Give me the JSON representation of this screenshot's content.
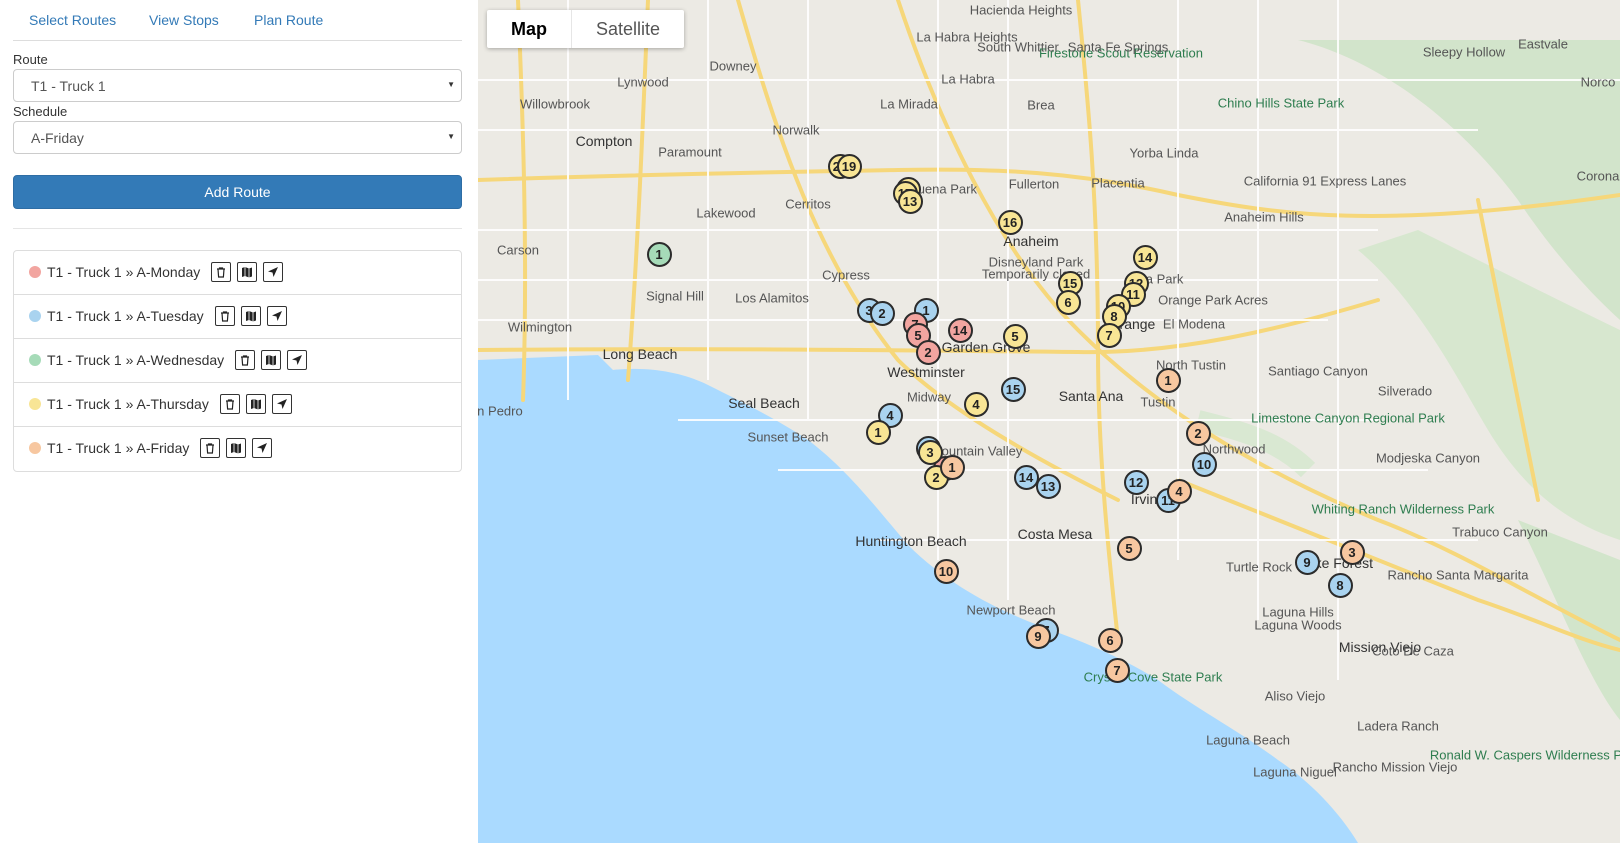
{
  "nav": {
    "items": [
      "Select Routes",
      "View Stops",
      "Plan Route"
    ]
  },
  "form": {
    "route_label": "Route",
    "route_value": "T1 - Truck 1",
    "schedule_label": "Schedule",
    "schedule_value": "A-Friday",
    "add_button": "Add Route"
  },
  "routes": [
    {
      "label": "T1 - Truck 1 » A-Monday",
      "color": "#f2a5a0"
    },
    {
      "label": "T1 - Truck 1 » A-Tuesday",
      "color": "#a9d3ef"
    },
    {
      "label": "T1 - Truck 1 » A-Wednesday",
      "color": "#a6dbb8"
    },
    {
      "label": "T1 - Truck 1 » A-Thursday",
      "color": "#f8e595"
    },
    {
      "label": "T1 - Truck 1 » A-Friday",
      "color": "#f7c7a0"
    }
  ],
  "route_icons": [
    "trash-icon",
    "map-icon",
    "navigate-arrow-icon"
  ],
  "map": {
    "type_buttons": [
      "Map",
      "Satellite"
    ],
    "place_labels": [
      "Downey",
      "Norwalk",
      "Paramount",
      "Compton",
      "Lynwood",
      "Willowbrook",
      "Lakewood",
      "Cerritos",
      "Carson",
      "Signal Hill",
      "Long Beach",
      "Los Alamitos",
      "Cypress",
      "Buena Park",
      "La Mirada",
      "La Habra",
      "Fullerton",
      "Brea",
      "Placentia",
      "Yorba Linda",
      "Anaheim",
      "Disneyland Park",
      "Temporarily closed",
      "Garden Grove",
      "Westminster",
      "Midway",
      "Orange",
      "El Modena",
      "Villa Park",
      "Santa Ana",
      "Tustin",
      "North Tustin",
      "Fountain Valley",
      "Costa Mesa",
      "Irvine",
      "Huntington Beach",
      "Seal Beach",
      "Sunset Beach",
      "Newport Beach",
      "Lake Forest",
      "Mission Viejo",
      "Laguna Hills",
      "Laguna Woods",
      "Aliso Viejo",
      "Laguna Beach",
      "Laguna Niguel",
      "Ladera Ranch",
      "Rancho Santa Margarita",
      "Trabuco Canyon",
      "Coto De Caza",
      "Corona",
      "Eastvale",
      "Norco",
      "Chino Hills State Park",
      "Firestone Scout Reservation",
      "Sleepy Hollow",
      "Whiting Ranch Wilderness Park",
      "Limestone Canyon Regional Park",
      "Crystal Cove State Park",
      "Silverado",
      "Modjeska Canyon",
      "Santiago Canyon",
      "Orange Park Acres",
      "Santa Fe Springs",
      "South Whittier",
      "Hacienda Heights",
      "La Habra Heights",
      "Rancho Mission Viejo",
      "Ronald W. Caspers Wilderness Park",
      "San Pedro",
      "Wilmington",
      "Anaheim Hills",
      "Turtle Rock",
      "Northwood",
      "California 91 Express Lanes"
    ],
    "markers": [
      {
        "n": "1",
        "color": "#a6dbb8"
      },
      {
        "n": "3",
        "color": "#a9d3ef"
      },
      {
        "n": "2",
        "color": "#a9d3ef"
      },
      {
        "n": "1",
        "color": "#a9d3ef"
      },
      {
        "n": "4",
        "color": "#a9d3ef"
      },
      {
        "n": "15",
        "color": "#a9d3ef"
      },
      {
        "n": "14",
        "color": "#a9d3ef"
      },
      {
        "n": "13",
        "color": "#a9d3ef"
      },
      {
        "n": "12",
        "color": "#a9d3ef"
      },
      {
        "n": "11",
        "color": "#a9d3ef"
      },
      {
        "n": "10",
        "color": "#a9d3ef"
      },
      {
        "n": "9",
        "color": "#a9d3ef"
      },
      {
        "n": "8",
        "color": "#a9d3ef"
      },
      {
        "n": "7",
        "color": "#a9d3ef"
      },
      {
        "n": "3",
        "color": "#a9d3ef"
      },
      {
        "n": "7",
        "color": "#f2a5a0"
      },
      {
        "n": "5",
        "color": "#f2a5a0"
      },
      {
        "n": "2",
        "color": "#f2a5a0"
      },
      {
        "n": "14",
        "color": "#f2a5a0"
      },
      {
        "n": "1",
        "color": "#f2a5a0"
      },
      {
        "n": "22",
        "color": "#f8e595"
      },
      {
        "n": "19",
        "color": "#f8e595"
      },
      {
        "n": "18",
        "color": "#f8e595"
      },
      {
        "n": "17",
        "color": "#f8e595"
      },
      {
        "n": "16",
        "color": "#f8e595"
      },
      {
        "n": "15",
        "color": "#f8e595"
      },
      {
        "n": "14",
        "color": "#f8e595"
      },
      {
        "n": "13",
        "color": "#f8e595"
      },
      {
        "n": "12",
        "color": "#f8e595"
      },
      {
        "n": "11",
        "color": "#f8e595"
      },
      {
        "n": "10",
        "color": "#f8e595"
      },
      {
        "n": "8",
        "color": "#f8e595"
      },
      {
        "n": "7",
        "color": "#f8e595"
      },
      {
        "n": "6",
        "color": "#f8e595"
      },
      {
        "n": "5",
        "color": "#f8e595"
      },
      {
        "n": "4",
        "color": "#f8e595"
      },
      {
        "n": "3",
        "color": "#f8e595"
      },
      {
        "n": "2",
        "color": "#f8e595"
      },
      {
        "n": "1",
        "color": "#f8e595"
      },
      {
        "n": "1",
        "color": "#f7c7a0"
      },
      {
        "n": "2",
        "color": "#f7c7a0"
      },
      {
        "n": "3",
        "color": "#f7c7a0"
      },
      {
        "n": "4",
        "color": "#f7c7a0"
      },
      {
        "n": "5",
        "color": "#f7c7a0"
      },
      {
        "n": "6",
        "color": "#f7c7a0"
      },
      {
        "n": "7",
        "color": "#f7c7a0"
      },
      {
        "n": "9",
        "color": "#f7c7a0"
      },
      {
        "n": "10",
        "color": "#f7c7a0"
      },
      {
        "n": "1",
        "color": "#f7c7a0"
      }
    ]
  }
}
